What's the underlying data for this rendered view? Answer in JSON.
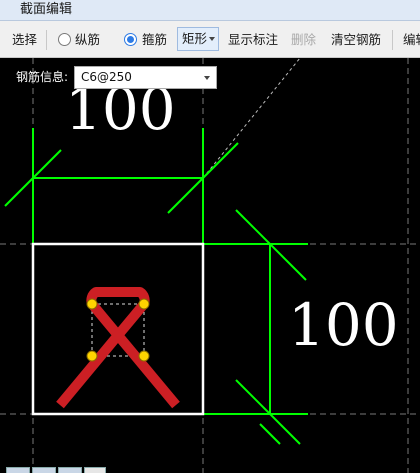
{
  "window": {
    "title": "截面编辑"
  },
  "toolbar": {
    "select_label": "选择",
    "longitudinal_label": "纵筋",
    "stirrup_label": "箍筋",
    "shape_label": "矩形",
    "show_annotation_label": "显示标注",
    "delete_label": "删除",
    "clear_rebar_label": "清空钢筋",
    "edit_label": "编辑",
    "selected_mode": "stirrup"
  },
  "rebar_info": {
    "label": "钢筋信息:",
    "value": "C6@250"
  },
  "dimensions": {
    "top": "100",
    "right": "100"
  },
  "colors": {
    "background": "#000000",
    "dimension_line": "#00ff00",
    "section_outline": "#ffffff",
    "stirrup": "#cc1f24",
    "rebar_point": "#ffd400",
    "guide_line": "#777777"
  }
}
